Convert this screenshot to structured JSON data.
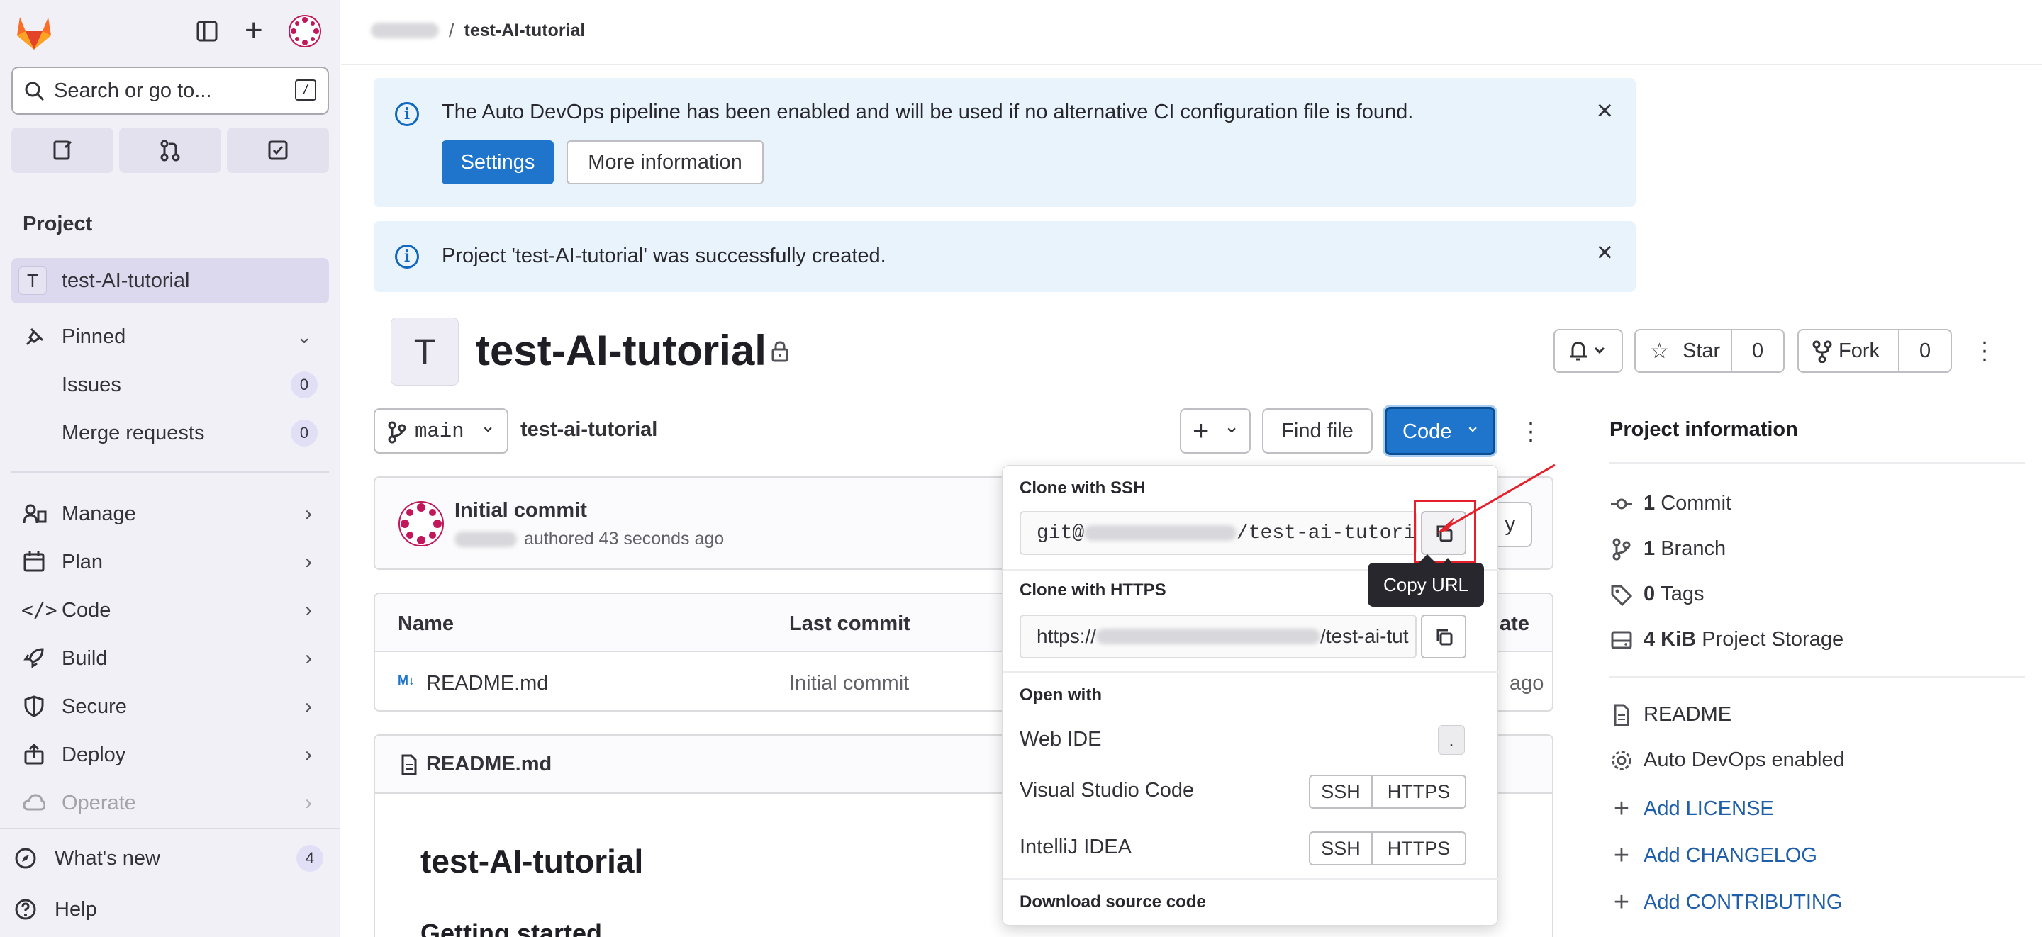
{
  "sidebar": {
    "search_placeholder": "Search or go to...",
    "search_shortcut": "/",
    "section_title": "Project",
    "project_initial": "T",
    "project_name": "test-AI-tutorial",
    "pinned_label": "Pinned",
    "pinned_items": [
      {
        "label": "Issues",
        "count": "0"
      },
      {
        "label": "Merge requests",
        "count": "0"
      }
    ],
    "nav": [
      {
        "label": "Manage"
      },
      {
        "label": "Plan"
      },
      {
        "label": "Code"
      },
      {
        "label": "Build"
      },
      {
        "label": "Secure"
      },
      {
        "label": "Deploy"
      },
      {
        "label": "Operate"
      }
    ],
    "whats_new_label": "What's new",
    "whats_new_count": "4",
    "help_label": "Help"
  },
  "breadcrumb": {
    "separator": "/",
    "current": "test-AI-tutorial"
  },
  "alerts": [
    {
      "text": "The Auto DevOps pipeline has been enabled and will be used if no alternative CI configuration file is found.",
      "primary": "Settings",
      "secondary": "More information"
    },
    {
      "text": "Project 'test-AI-tutorial' was successfully created."
    }
  ],
  "project": {
    "avatar_initial": "T",
    "title": "test-AI-tutorial",
    "star_label": "Star",
    "star_count": "0",
    "fork_label": "Fork",
    "fork_count": "0"
  },
  "toolbar": {
    "branch": "main",
    "path": "test-ai-tutorial",
    "find_file": "Find file",
    "code": "Code"
  },
  "commit": {
    "title": "Initial commit",
    "meta": "authored 43 seconds ago",
    "partial_button": "y"
  },
  "files": {
    "headers": {
      "name": "Name",
      "last_commit": "Last commit",
      "date": "ate"
    },
    "rows": [
      {
        "name": "README.md",
        "commit": "Initial commit",
        "date": "ago"
      }
    ]
  },
  "readme": {
    "header": "README.md",
    "h1": "test-AI-tutorial",
    "h2": "Getting started"
  },
  "project_info": {
    "title": "Project information",
    "stats": [
      {
        "num": "1",
        "label": "Commit",
        "icon": "commit-icon"
      },
      {
        "num": "1",
        "label": "Branch",
        "icon": "branch-icon"
      },
      {
        "num": "0",
        "label": "Tags",
        "icon": "tag-icon"
      },
      {
        "num": "4 KiB",
        "label": "Project Storage",
        "icon": "storage-icon"
      }
    ],
    "readme_link": "README",
    "auto_devops": "Auto DevOps enabled",
    "add_links": [
      "Add LICENSE",
      "Add CHANGELOG",
      "Add CONTRIBUTING"
    ]
  },
  "clone_dropdown": {
    "ssh_title": "Clone with SSH",
    "ssh_prefix": "git@",
    "ssh_suffix": "/test-ai-tutori",
    "https_title": "Clone with HTTPS",
    "https_prefix": "https://",
    "https_suffix": "/test-ai-tut",
    "tooltip": "Copy URL",
    "open_with_title": "Open with",
    "web_ide": "Web IDE",
    "web_ide_key": ".",
    "vscode": "Visual Studio Code",
    "intellij": "IntelliJ IDEA",
    "ssh": "SSH",
    "https": "HTTPS",
    "download_title": "Download source code"
  },
  "colors": {
    "accent": "#1f75cb",
    "annotation": "#e5202b"
  }
}
